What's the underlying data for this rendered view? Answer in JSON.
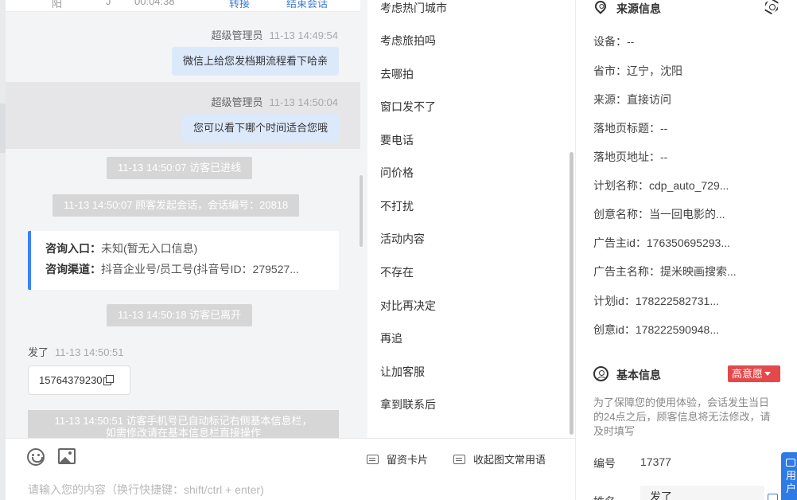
{
  "chat": {
    "top_cut": {
      "c1": "阳",
      "c2": "J",
      "time": "00:04:38",
      "transfer": "转接",
      "end_chat": "结束会话"
    },
    "messages": [
      {
        "sender": "超级管理员",
        "time": "11-13 14:49:54",
        "text": "微信上给您发档期流程看下哈亲"
      },
      {
        "sender": "超级管理员",
        "time": "11-13 14:50:04",
        "text": "您可以看下哪个时间适合您哦"
      }
    ],
    "system": {
      "entered": "11-13 14:50:07 访客已进线",
      "started": "11-13 14:50:07 顾客发起会话，会话编号：20818",
      "left": "11-13 14:50:18 访客已离开",
      "auto_mark_line1": "11-13 14:50:51 访客手机号已自动标记右侧基本信息栏，",
      "auto_mark_line2": "如需修改请在基本信息栏直接操作"
    },
    "info_card": {
      "entry_label": "咨询入口：",
      "entry_value": "未知(暂无入口信息)",
      "channel_label": "咨询渠道：",
      "channel_value": "抖音企业号/员工号(抖音号ID：279527..."
    },
    "visitor": {
      "name": "发了",
      "time": "11-13 14:50:51",
      "phone": "15764379230"
    },
    "composer": {
      "emoji_icon": "emoji-icon",
      "image_icon": "image-icon",
      "card_button": "留资卡片",
      "collapse_button": "收起图文常用语",
      "placeholder": "请输入您的内容（换行快捷键：shift/ctrl + enter)"
    }
  },
  "quick_replies": [
    "考虑热门城市",
    "考虑旅拍吗",
    "去哪拍",
    "窗口发不了",
    "要电话",
    "问价格",
    "不打扰",
    "活动内容",
    "不存在",
    "对比再决定",
    "再追",
    "让加客服",
    "拿到联系后"
  ],
  "source": {
    "title": "来源信息",
    "rows": [
      "设备：--",
      "省市：辽宁，沈阳",
      "来源：直接访问",
      "落地页标题：--",
      "落地页地址：--",
      "计划名称：cdp_auto_729...",
      "创意名称：当一回电影的...",
      "广告主id：176350695293...",
      "广告主名称：提米映画搜索...",
      "计划id：178222582731...",
      "创意id：178222590948..."
    ]
  },
  "basic": {
    "title": "基本信息",
    "intent": "高意愿",
    "notice": "为了保障您的使用体验，会话发生当日的24点之后，顾客信息将无法修改，请及时填写",
    "id_label": "编号",
    "id_value": "17377",
    "name_label": "姓名",
    "name_value": "发了",
    "float_label": "用户"
  }
}
